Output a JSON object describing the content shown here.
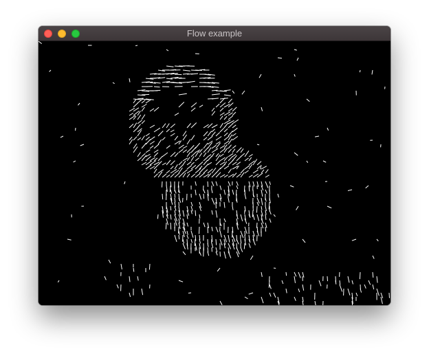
{
  "window": {
    "title": "Flow example",
    "controls": {
      "close": "close-button",
      "minimize": "minimize-button",
      "zoom": "zoom-button"
    }
  },
  "canvas": {
    "background_color": "#000000",
    "vector_color": "#ffffff"
  }
}
